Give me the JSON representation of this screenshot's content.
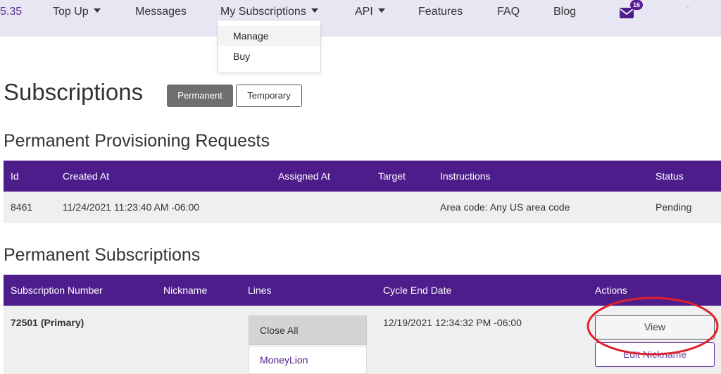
{
  "nav": {
    "balance": "5.35",
    "items": [
      {
        "label": "Top Up"
      },
      {
        "label": "Messages"
      },
      {
        "label": "My Subscriptions"
      },
      {
        "label": "API"
      },
      {
        "label": "Features"
      },
      {
        "label": "FAQ"
      },
      {
        "label": "Blog"
      }
    ],
    "mail_badge": "16",
    "icons": {
      "mail": "envelope-icon"
    },
    "accent_color": "#4e1d8c"
  },
  "dropdown": {
    "items": [
      {
        "label": "Manage"
      },
      {
        "label": "Buy"
      }
    ]
  },
  "page": {
    "title": "Subscriptions",
    "toggle": {
      "permanent": "Permanent",
      "temporary": "Temporary"
    }
  },
  "requests": {
    "title": "Permanent Provisioning Requests",
    "headers": [
      "Id",
      "Created At",
      "Assigned At",
      "Target",
      "Instructions",
      "Status"
    ],
    "rows": [
      {
        "id": "8461",
        "created_at": "11/24/2021 11:23:40 AM -06:00",
        "assigned_at": "",
        "target": "",
        "instructions": "Area code: Any US area code",
        "status": "Pending"
      }
    ]
  },
  "subscriptions": {
    "title": "Permanent Subscriptions",
    "headers": [
      "Subscription Number",
      "Nickname",
      "Lines",
      "Cycle End Date",
      "Actions"
    ],
    "rows": [
      {
        "number": "72501 (Primary)",
        "nickname": "",
        "lines_toggle": "Close All",
        "lines": [
          "MoneyLion"
        ],
        "cycle_end": "12/19/2021 12:34:32 PM -06:00",
        "actions": {
          "view": "View",
          "edit": "Edit Nickname"
        }
      }
    ]
  },
  "annotation_color": "#e0202a"
}
